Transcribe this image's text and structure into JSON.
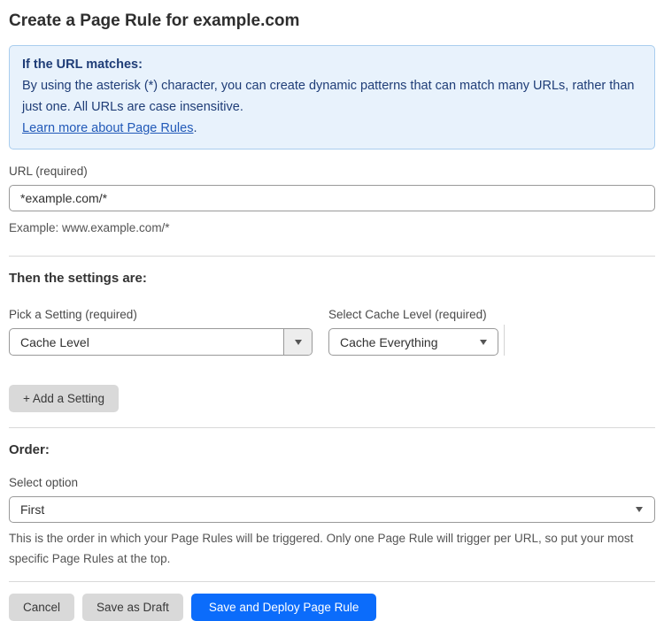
{
  "page": {
    "title": "Create a Page Rule for example.com"
  },
  "info_box": {
    "heading": "If the URL matches:",
    "body": "By using the asterisk (*) character, you can create dynamic patterns that can match many URLs, rather than just one. All URLs are case insensitive.",
    "link_label": "Learn more about Page Rules",
    "link_suffix": "."
  },
  "url_field": {
    "label": "URL (required)",
    "value": "*example.com/*",
    "helper": "Example: www.example.com/*"
  },
  "settings_section": {
    "heading": "Then the settings are:",
    "setting_select": {
      "label": "Pick a Setting (required)",
      "value": "Cache Level"
    },
    "cache_level_select": {
      "label": "Select Cache Level (required)",
      "value": "Cache Everything"
    },
    "add_setting_label": "+ Add a Setting"
  },
  "order_section": {
    "heading": "Order:",
    "select_label": "Select option",
    "select_value": "First",
    "helper": "This is the order in which your Page Rules will be triggered. Only one Page Rule will trigger per URL, so put your most specific Page Rules at the top."
  },
  "actions": {
    "cancel": "Cancel",
    "save_draft": "Save as Draft",
    "save_deploy": "Save and Deploy Page Rule"
  },
  "icons": {
    "dropdown_arrow": "▼"
  },
  "colors": {
    "accent": "#0b6cfb",
    "info_bg": "#e8f2fc",
    "info_border": "#a9cdee",
    "info_text": "#1f3d77",
    "link": "#2159b8",
    "divider": "#d8d8d8",
    "field_border": "#999999",
    "btn_gray": "#d9d9d9"
  }
}
